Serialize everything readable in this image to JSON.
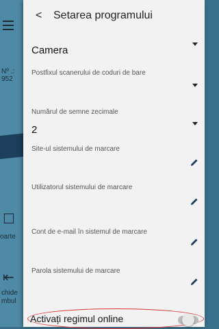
{
  "background": {
    "po_label": "Nº .:",
    "po_number": "952",
    "item_raport": "oarte",
    "item_inchide_1": "chide",
    "item_inchide_2": "mbul"
  },
  "header": {
    "back": "<",
    "title": "Setarea programului"
  },
  "settings": {
    "scanner": {
      "value": "Camera"
    },
    "barcode_suffix": {
      "label": "Postfixul scanerului de coduri de bare",
      "value": ""
    },
    "decimals": {
      "label": "Numărul de semne zecimale",
      "value": "2"
    },
    "marking_site": {
      "label": "Site-ul sistemului de marcare"
    },
    "marking_user": {
      "label": "Utilizatorul sistemului de marcare"
    },
    "marking_email": {
      "label": "Cont de e-mail în sistemul de marcare"
    },
    "marking_password": {
      "label": "Parola sistemului de marcare"
    },
    "online_mode": {
      "label": "Activați regimul online",
      "enabled": false
    }
  },
  "colors": {
    "panel": "#f2f2f2",
    "accent": "#1e3a5f",
    "highlight": "#dd3333"
  }
}
